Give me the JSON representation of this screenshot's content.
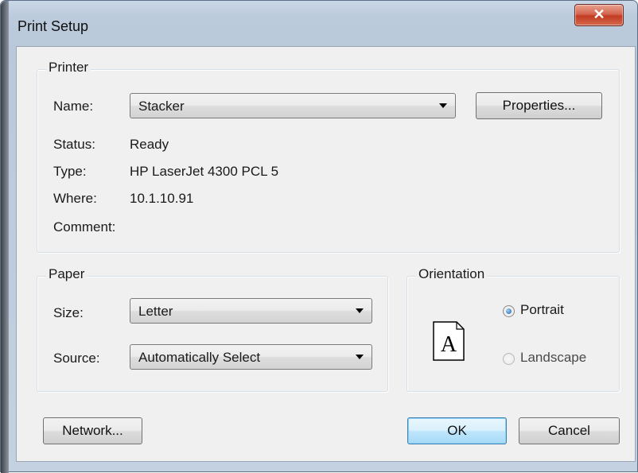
{
  "window": {
    "title": "Print Setup",
    "close_icon": "close-icon"
  },
  "printer": {
    "legend": "Printer",
    "name_label": "Name:",
    "name_value": "Stacker",
    "properties_button": "Properties...",
    "status_label": "Status:",
    "status_value": "Ready",
    "type_label": "Type:",
    "type_value": "HP LaserJet 4300 PCL 5",
    "where_label": "Where:",
    "where_value": "10.1.10.91",
    "comment_label": "Comment:",
    "comment_value": ""
  },
  "paper": {
    "legend": "Paper",
    "size_label": "Size:",
    "size_value": "Letter",
    "source_label": "Source:",
    "source_value": "Automatically Select"
  },
  "orientation": {
    "legend": "Orientation",
    "page_icon": "page-portrait-icon",
    "page_letter": "A",
    "portrait_label": "Portrait",
    "landscape_label": "Landscape",
    "selected": "Portrait"
  },
  "buttons": {
    "network": "Network...",
    "ok": "OK",
    "cancel": "Cancel"
  }
}
